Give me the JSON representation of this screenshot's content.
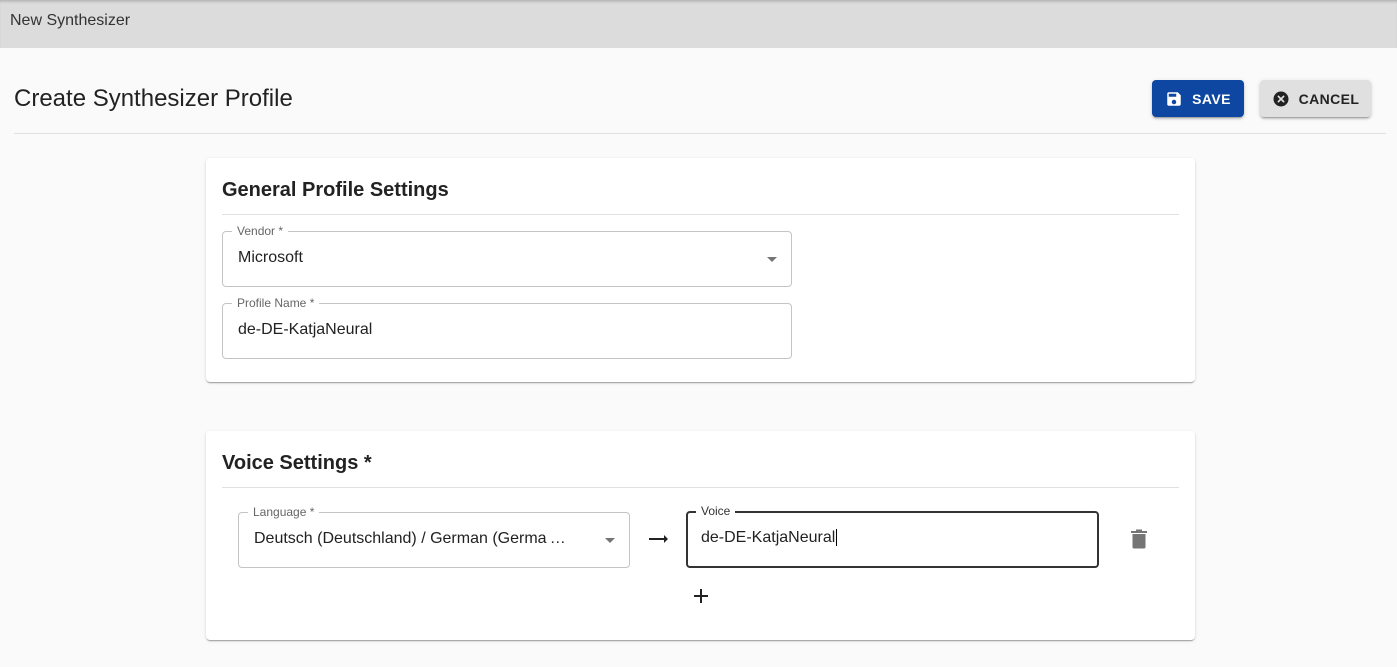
{
  "topbar": {
    "title": "New Synthesizer"
  },
  "header": {
    "title": "Create Synthesizer Profile",
    "save_label": "SAVE",
    "cancel_label": "CANCEL",
    "save_color": "#0d47a1",
    "cancel_color": "#e0e0e0"
  },
  "general": {
    "title": "General Profile Settings",
    "vendor": {
      "label": "Vendor *",
      "value": "Microsoft"
    },
    "profile_name": {
      "label": "Profile Name *",
      "value": "de-DE-KatjaNeural"
    }
  },
  "voice": {
    "title": "Voice Settings *",
    "rows": [
      {
        "language": {
          "label": "Language *",
          "value": "Deutsch (Deutschland) / German (Germa …"
        },
        "voice": {
          "label": "Voice",
          "value": "de-DE-KatjaNeural"
        }
      }
    ]
  },
  "icons": {
    "save": "floppy-disk-icon",
    "cancel": "cancel-circle-icon",
    "dropdown": "chevron-down-icon",
    "mapping": "arrow-right-icon",
    "delete": "trash-icon",
    "add": "plus-icon"
  }
}
